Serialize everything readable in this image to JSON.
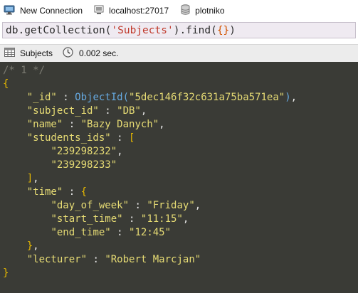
{
  "connection": {
    "name": "New Connection",
    "host": "localhost:27017",
    "database": "plotniko"
  },
  "query": {
    "prefix": "db.getCollection(",
    "collection_literal": "'Subjects'",
    "method": ").find(",
    "args": "{}",
    "close": ")"
  },
  "result": {
    "collection": "Subjects",
    "time": "0.002 sec."
  },
  "document": {
    "index_comment": "/* 1 */",
    "open_brace": "{",
    "close_brace": "}",
    "id_key": "\"_id\"",
    "id_fn": "ObjectId",
    "id_value": "\"5dec146f32c631a75ba571ea\"",
    "subject_id_key": "\"subject_id\"",
    "subject_id_value": "\"DB\"",
    "name_key": "\"name\"",
    "name_value": "\"Bazy Danych\"",
    "students_ids_key": "\"students_ids\"",
    "students_ids": [
      "\"239298232\"",
      "\"239298233\""
    ],
    "time_key": "\"time\"",
    "day_of_week_key": "\"day_of_week\"",
    "day_of_week_value": "\"Friday\"",
    "start_time_key": "\"start_time\"",
    "start_time_value": "\"11:15\"",
    "end_time_key": "\"end_time\"",
    "end_time_value": "\"12:45\"",
    "lecturer_key": "\"lecturer\"",
    "lecturer_value": "\"Robert Marcjan\""
  },
  "colors": {
    "editor_bg": "#3a3b36",
    "key": "#e6db74",
    "function": "#66a9e0",
    "comment": "#7b7b72"
  },
  "icons": {
    "connection": "monitor-icon",
    "host": "computer-icon",
    "database": "database-icon",
    "collection": "table-icon",
    "time": "clock-icon"
  }
}
